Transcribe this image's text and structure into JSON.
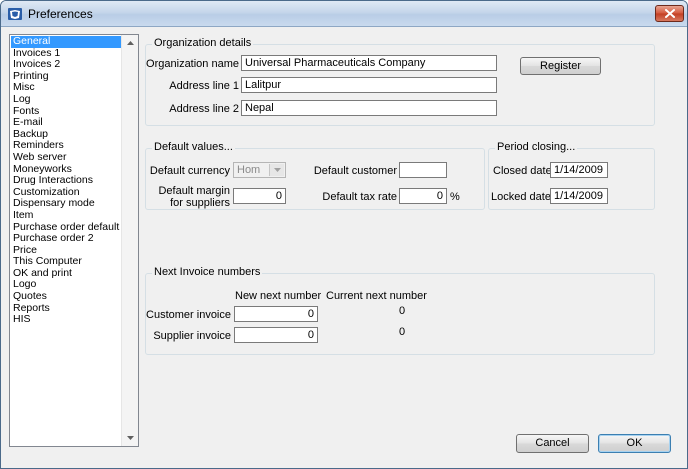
{
  "window": {
    "title": "Preferences"
  },
  "categories": {
    "selected": "General",
    "items": [
      "General",
      "Invoices 1",
      "Invoices 2",
      "Printing",
      "Misc",
      "Log",
      "Fonts",
      "E-mail",
      "Backup",
      "Reminders",
      "Web server",
      "Moneyworks",
      "Drug Interactions",
      "Customization",
      "Dispensary mode",
      "Item",
      "Purchase order default",
      "Purchase order 2",
      "Price",
      "This Computer",
      "OK and print",
      "Logo",
      "Quotes",
      "Reports",
      "HIS"
    ]
  },
  "organization": {
    "group_label": "Organization details",
    "name_label": "Organization name",
    "name_value": "Universal Pharmaceuticals Company",
    "address1_label": "Address line 1",
    "address1_value": "Lalitpur",
    "address2_label": "Address line 2",
    "address2_value": "Nepal",
    "register_label": "Register"
  },
  "defaults": {
    "group_label": "Default values...",
    "currency_label": "Default currency",
    "currency_value": "Hom",
    "customer_label": "Default customer",
    "customer_value": "",
    "margin_label_line1": "Default margin",
    "margin_label_line2": "for suppliers",
    "margin_value": "0",
    "tax_label": "Default tax rate",
    "tax_value": "0",
    "tax_unit": "%"
  },
  "period": {
    "group_label": "Period closing...",
    "closed_label": "Closed date",
    "closed_value": "1/14/2009",
    "locked_label": "Locked date",
    "locked_value": "1/14/2009"
  },
  "invoice_numbers": {
    "group_label": "Next Invoice numbers",
    "new_header": "New next number",
    "current_header": "Current next number",
    "customer_label": "Customer invoice",
    "customer_new": "0",
    "customer_current": "0",
    "supplier_label": "Supplier invoice",
    "supplier_new": "0",
    "supplier_current": "0"
  },
  "footer": {
    "cancel_label": "Cancel",
    "ok_label": "OK"
  },
  "colors": {
    "selection": "#3399ff",
    "close_button": "#c94a2e"
  }
}
